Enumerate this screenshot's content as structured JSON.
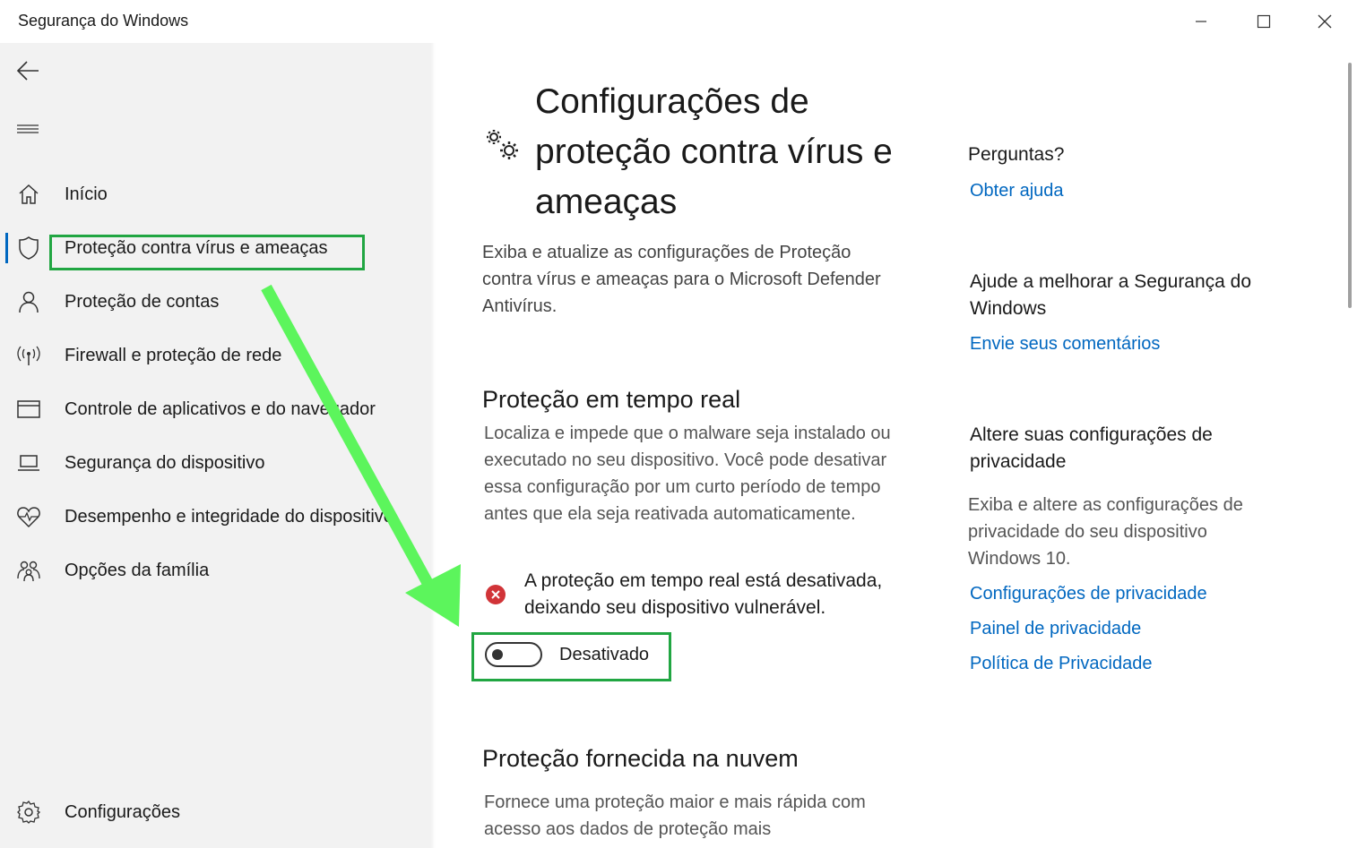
{
  "window": {
    "title": "Segurança do Windows"
  },
  "sidebar": {
    "items": [
      {
        "label": "Início",
        "icon": "home-icon"
      },
      {
        "label": "Proteção contra vírus e ameaças",
        "icon": "shield-icon",
        "active": true
      },
      {
        "label": "Proteção de contas",
        "icon": "person-icon"
      },
      {
        "label": "Firewall e proteção de rede",
        "icon": "antenna-icon"
      },
      {
        "label": "Controle de aplicativos e do navegador",
        "icon": "browser-window-icon"
      },
      {
        "label": "Segurança do dispositivo",
        "icon": "laptop-icon"
      },
      {
        "label": "Desempenho e integridade do dispositivo",
        "icon": "heart-pulse-icon"
      },
      {
        "label": "Opções da família",
        "icon": "family-icon"
      }
    ],
    "settings_label": "Configurações"
  },
  "main": {
    "title": "Configurações de proteção contra vírus e ameaças",
    "description": "Exiba e atualize as configurações de Proteção contra vírus e ameaças para o Microsoft Defender Antivírus.",
    "realtime": {
      "title": "Proteção em tempo real",
      "description": "Localiza e impede que o malware seja instalado ou executado no seu dispositivo. Você pode desativar essa configuração por um curto período de tempo antes que ela seja reativada automaticamente.",
      "warning": "A proteção em tempo real está desativada, deixando seu dispositivo vulnerável.",
      "toggle_label": "Desativado",
      "toggle_on": false
    },
    "cloud": {
      "title": "Proteção fornecida na nuvem",
      "description": "Fornece uma proteção maior e mais rápida com acesso aos dados de proteção mais"
    }
  },
  "aside": {
    "questions_heading": "Perguntas?",
    "get_help_link": "Obter ajuda",
    "improve_heading": "Ajude a melhorar a Segurança do Windows",
    "feedback_link": "Envie seus comentários",
    "privacy_heading": "Altere suas configurações de privacidade",
    "privacy_desc": "Exiba e altere as configurações de privacidade do seu dispositivo Windows 10.",
    "privacy_links": [
      "Configurações de privacidade",
      "Painel de privacidade",
      "Política de Privacidade"
    ]
  },
  "colors": {
    "accent": "#0067c0",
    "highlight": "#21a642",
    "arrow": "#5cf55c",
    "error": "#d13438",
    "sidebar_bg": "#f2f2f2"
  }
}
